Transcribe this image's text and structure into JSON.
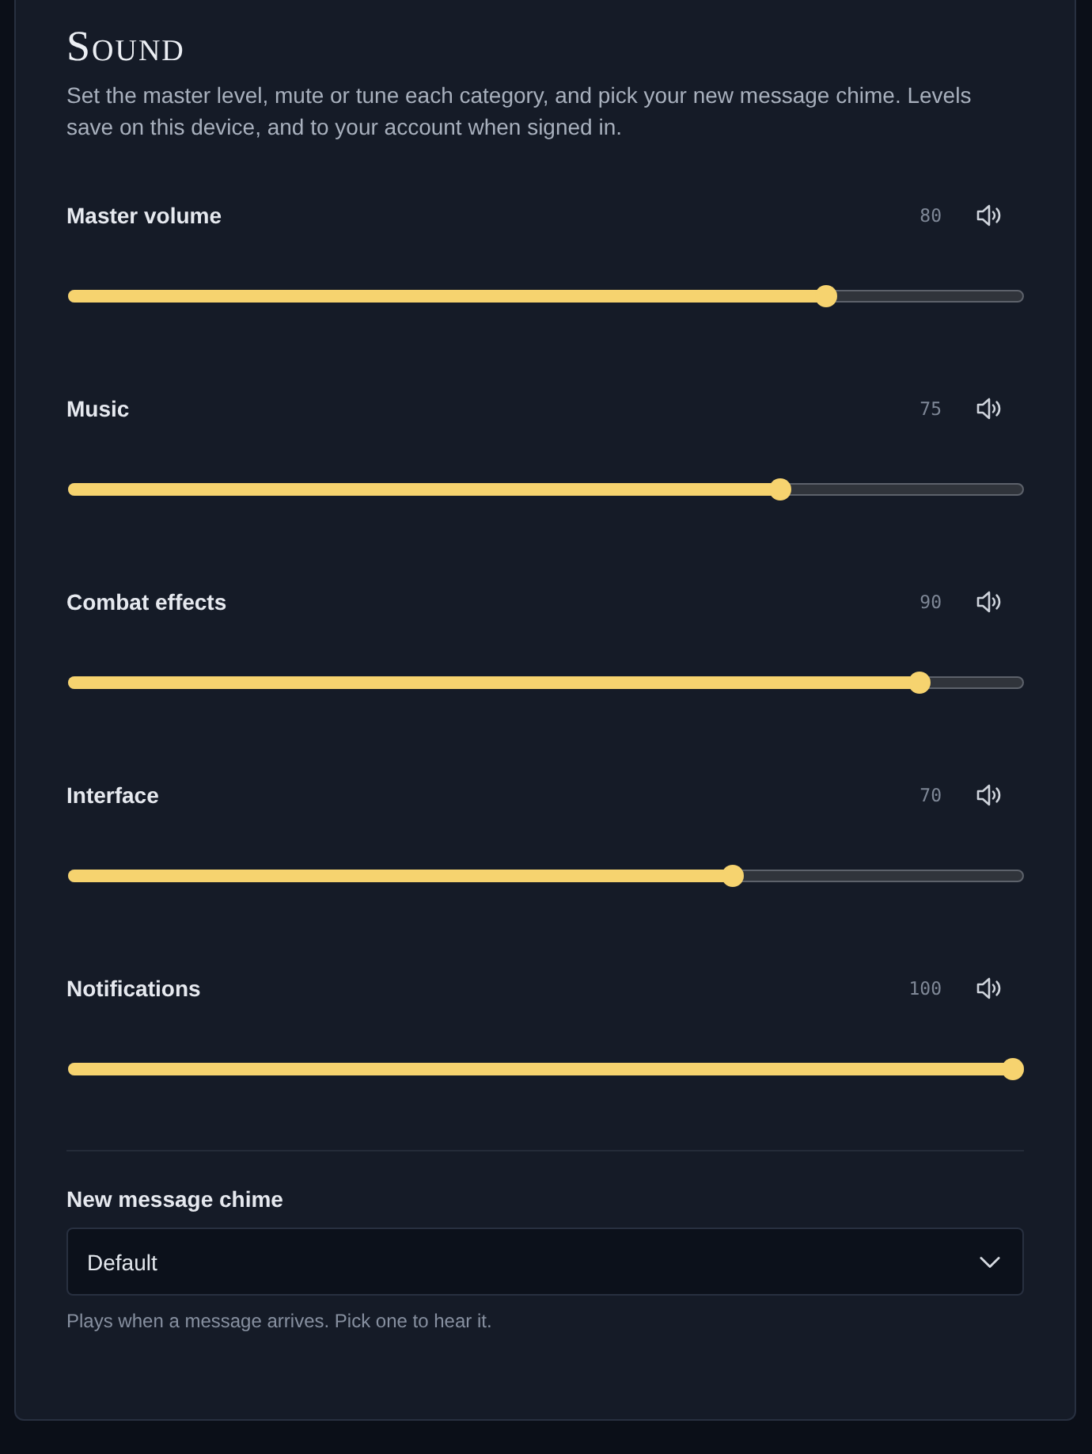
{
  "section": {
    "title": "Sound",
    "description": "Set the master level, mute or tune each category, and pick your new message chime. Levels save on this device, and to your account when signed in."
  },
  "channels": [
    {
      "name": "Master volume",
      "reading": "80",
      "level": 0.8,
      "muted": false
    },
    {
      "name": "Music",
      "reading": "75",
      "level": 0.75,
      "muted": false
    },
    {
      "name": "Combat effects",
      "reading": "90",
      "level": 0.9,
      "muted": false
    },
    {
      "name": "Interface",
      "reading": "70",
      "level": 0.7,
      "muted": false
    },
    {
      "name": "Notifications",
      "reading": "100",
      "level": 1.0,
      "muted": false
    }
  ],
  "chime": {
    "label": "New message chime",
    "value": "Default",
    "hint": "Plays when a message arrives. Pick one to hear it."
  }
}
